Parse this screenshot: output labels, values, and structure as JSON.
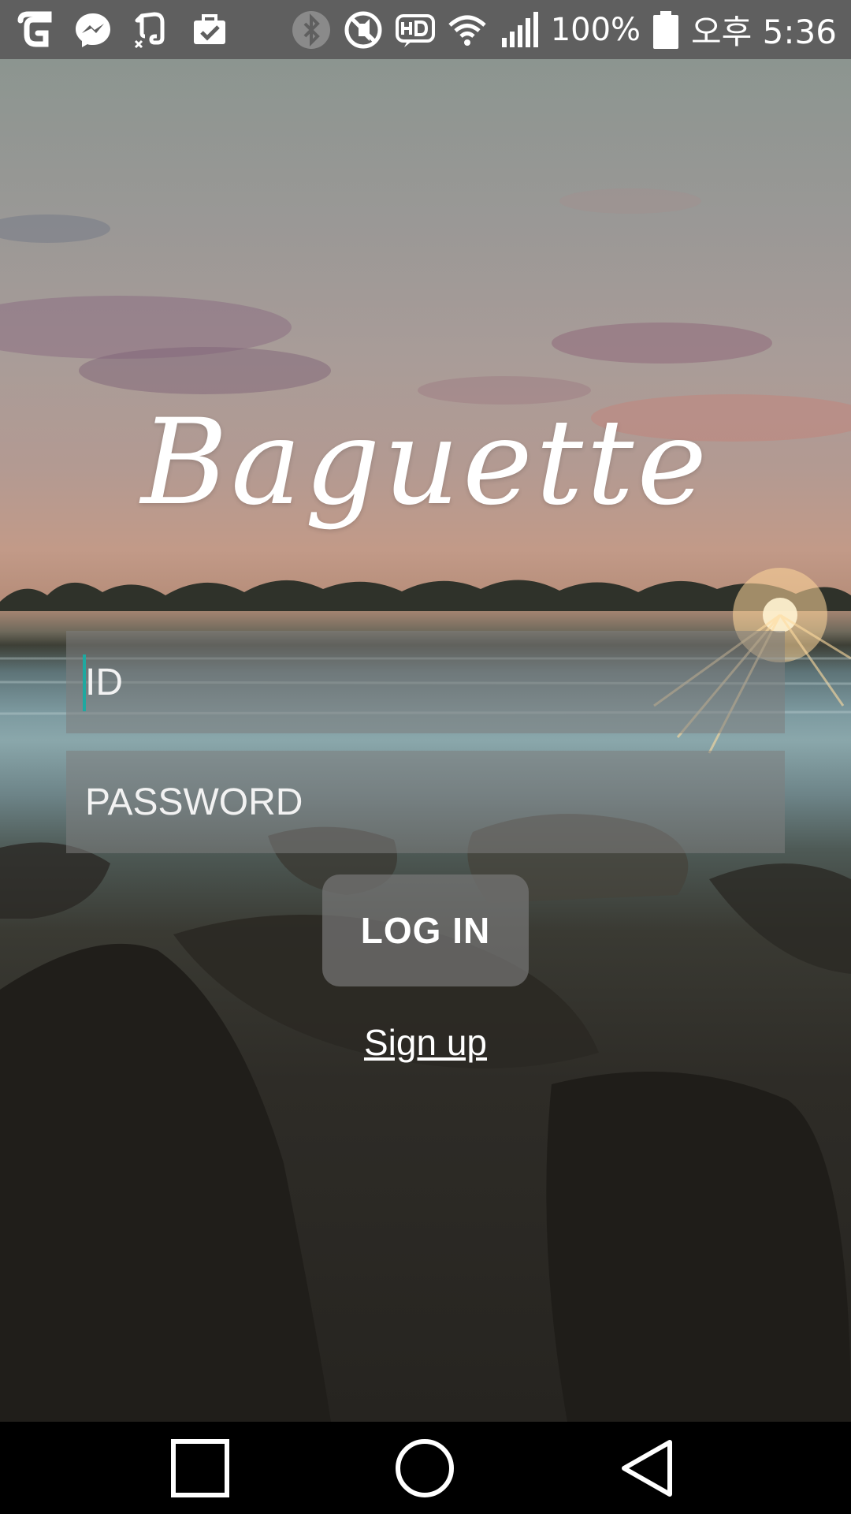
{
  "status_bar": {
    "icons_left": [
      "carrier-icon",
      "messenger-icon",
      "evernote-icon",
      "briefcase-check-icon"
    ],
    "icons_right": [
      "bluetooth-icon",
      "mute-icon",
      "hd-voice-icon",
      "wifi-icon",
      "signal-icon"
    ],
    "battery_percent": "100%",
    "time": "오후 5:36"
  },
  "app": {
    "logo_text": "Baguette"
  },
  "login_form": {
    "id_placeholder": "ID",
    "password_placeholder": "PASSWORD",
    "login_label": "LOG IN",
    "signup_label": "Sign up"
  },
  "nav_bar": {
    "buttons": [
      "recents",
      "home",
      "back"
    ]
  },
  "colors": {
    "status_bar_bg": "#5f5f5f",
    "cursor_accent": "#1fa8a0",
    "field_bg": "rgba(125,125,125,0.55)"
  }
}
